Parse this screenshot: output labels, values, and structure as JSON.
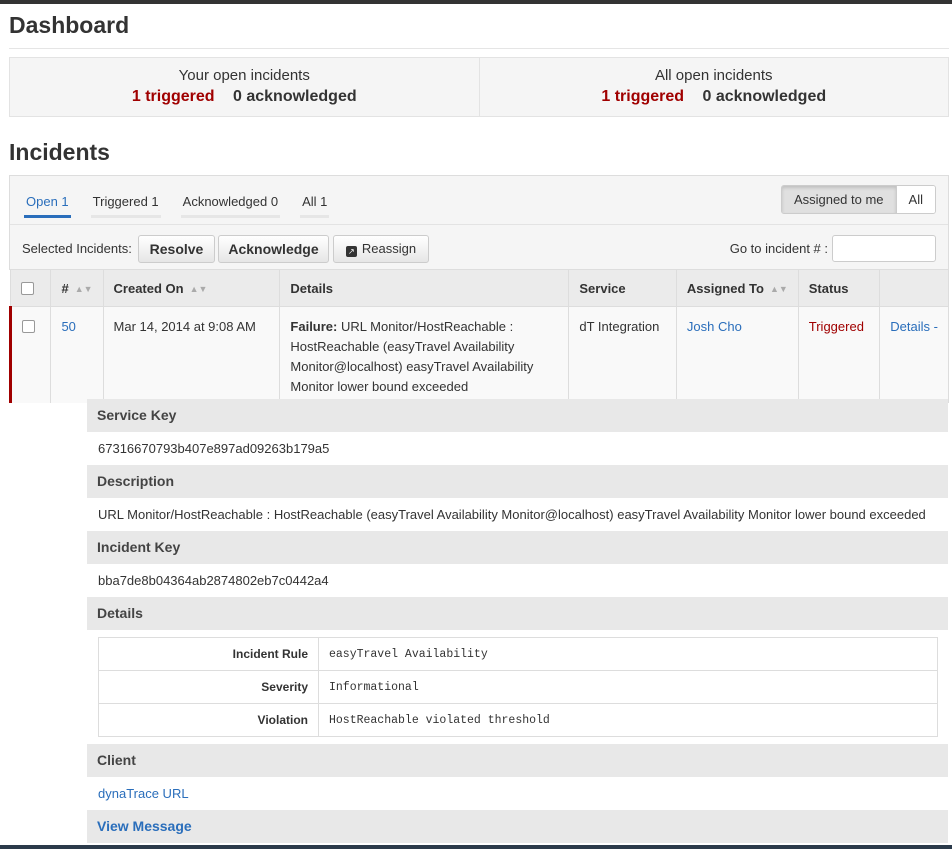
{
  "dashboard": {
    "title": "Dashboard",
    "your_open": {
      "title": "Your open incidents",
      "triggered": "1 triggered",
      "acknowledged": "0 acknowledged"
    },
    "all_open": {
      "title": "All open incidents",
      "triggered": "1 triggered",
      "acknowledged": "0 acknowledged"
    }
  },
  "incidents": {
    "title": "Incidents",
    "tabs": [
      {
        "label": "Open 1",
        "active": true
      },
      {
        "label": "Triggered 1",
        "active": false
      },
      {
        "label": "Acknowledged 0",
        "active": false
      },
      {
        "label": "All 1",
        "active": false
      }
    ],
    "filter": {
      "assigned_to_me": "Assigned to me",
      "all": "All",
      "selected": "Assigned to me"
    },
    "selected_label": "Selected Incidents:",
    "actions": {
      "resolve": "Resolve",
      "acknowledge": "Acknowledge",
      "reassign": "Reassign"
    },
    "goto_label": "Go to incident # :",
    "columns": {
      "number": "#",
      "created_on": "Created On",
      "details": "Details",
      "service": "Service",
      "assigned_to": "Assigned To",
      "status": "Status"
    },
    "row": {
      "number": "50",
      "created_on": "Mar 14, 2014 at 9:08 AM",
      "details_prefix": "Failure:",
      "details_text": "URL Monitor/HostReachable : HostReachable (easyTravel Availability Monitor@localhost) easyTravel Availability Monitor lower bound exceeded",
      "service": "dT Integration",
      "assigned_to": "Josh Cho",
      "status": "Triggered",
      "details_link": "Details",
      "trailing": "-"
    }
  },
  "detail": {
    "service_key_label": "Service Key",
    "service_key": "67316670793b407e897ad09263b179a5",
    "description_label": "Description",
    "description": "URL Monitor/HostReachable : HostReachable (easyTravel Availability Monitor@localhost) easyTravel Availability Monitor lower bound exceeded",
    "incident_key_label": "Incident Key",
    "incident_key": "bba7de8b04364ab2874802eb7c0442a4",
    "details_label": "Details",
    "details_rows": [
      {
        "key": "Incident Rule",
        "value": "easyTravel Availability"
      },
      {
        "key": "Severity",
        "value": "Informational"
      },
      {
        "key": "Violation",
        "value": "HostReachable violated threshold"
      }
    ],
    "client_label": "Client",
    "client_link": "dynaTrace URL",
    "view_message": "View Message"
  },
  "colors": {
    "triggered": "#a00000",
    "link": "#2a6ebb"
  }
}
